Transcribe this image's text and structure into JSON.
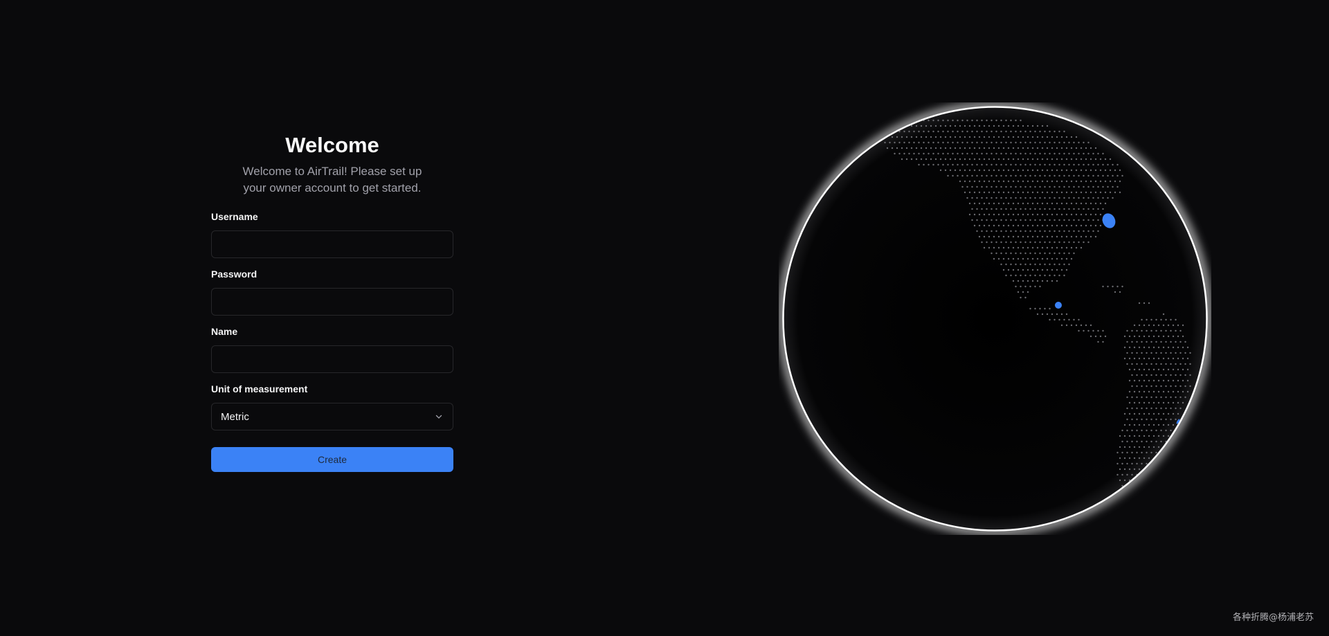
{
  "form": {
    "title": "Welcome",
    "subtitle": "Welcome to AirTrail! Please set up your owner account to get started.",
    "fields": {
      "username": {
        "label": "Username",
        "value": "",
        "placeholder": ""
      },
      "password": {
        "label": "Password",
        "value": "",
        "placeholder": ""
      },
      "name": {
        "label": "Name",
        "value": "",
        "placeholder": ""
      }
    },
    "unit": {
      "label": "Unit of measurement",
      "selected": "Metric"
    },
    "create_label": "Create"
  },
  "globe": {
    "accent_color": "#3b82f6",
    "outline_color": "#ffffff",
    "marker_icon": "location-marker-icon"
  },
  "watermark": "各种折腾@杨浦老苏",
  "colors": {
    "background": "#0a0a0c",
    "accent": "#3b82f6"
  }
}
